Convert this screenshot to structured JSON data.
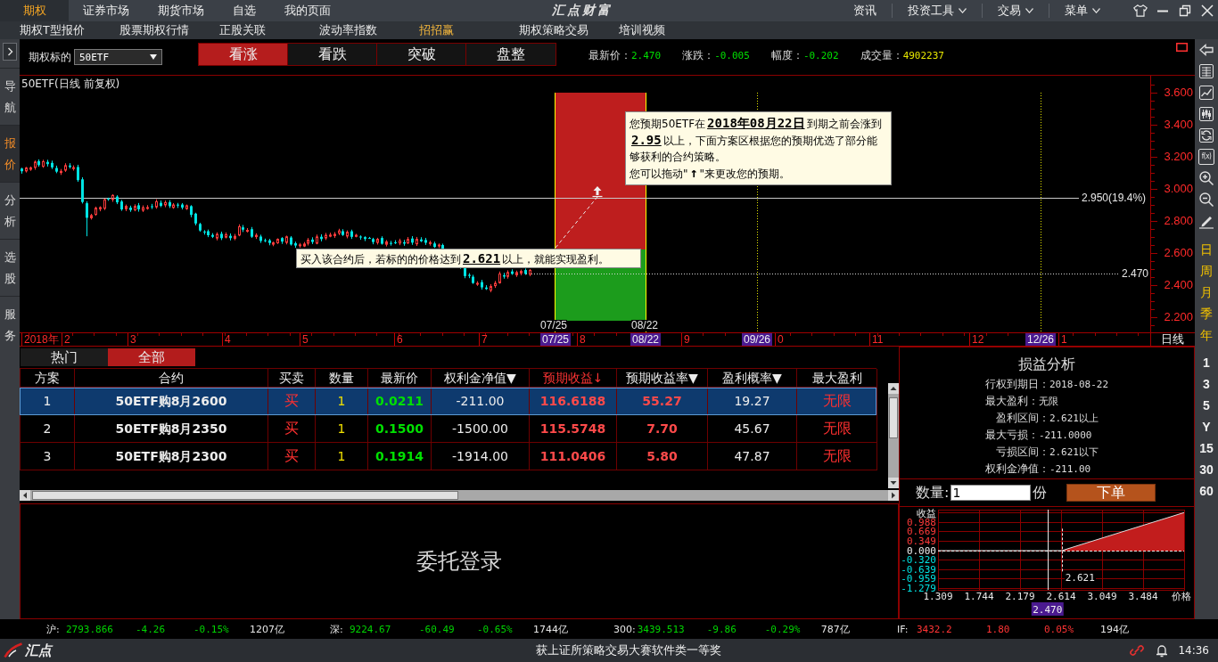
{
  "menu_bar": {
    "tabs": [
      {
        "label": "期权",
        "selected": true
      },
      {
        "label": "证券市场",
        "selected": false
      },
      {
        "label": "期货市场",
        "selected": false
      },
      {
        "label": "自选",
        "selected": false
      },
      {
        "label": "我的页面",
        "selected": false
      }
    ],
    "logo": "汇点财富",
    "menus": [
      {
        "label": "资讯",
        "dropdown": false
      },
      {
        "label": "投资工具",
        "dropdown": true
      },
      {
        "label": "交易",
        "dropdown": true
      },
      {
        "label": "菜单",
        "dropdown": true
      }
    ]
  },
  "sub_tabs": [
    {
      "label": "期权T型报价",
      "selected": false
    },
    {
      "label": "股票期权行情",
      "selected": false
    },
    {
      "label": "正股关联",
      "selected": false
    },
    {
      "label": "波动率指数",
      "selected": false
    },
    {
      "label": "招招赢",
      "selected": true
    },
    {
      "label": "期权策略交易",
      "selected": false
    },
    {
      "label": "培训视频",
      "selected": false
    }
  ],
  "left_nav": [
    {
      "label": "导航",
      "selected": false
    },
    {
      "label": "报价",
      "selected": true
    },
    {
      "label": "分析",
      "selected": false
    },
    {
      "label": "选股",
      "selected": false
    },
    {
      "label": "服务",
      "selected": false
    }
  ],
  "controls": {
    "underlying_label": "期权标的",
    "underlying_value": "50ETF",
    "outlooks": [
      {
        "label": "看涨",
        "selected": true
      },
      {
        "label": "看跌",
        "selected": false
      },
      {
        "label": "突破",
        "selected": false
      },
      {
        "label": "盘整",
        "selected": false
      }
    ],
    "quotes": [
      {
        "label": "最新价：",
        "value": "2.470",
        "color": "#00e000"
      },
      {
        "label": "涨跌：",
        "value": "-0.005",
        "color": "#00e000"
      },
      {
        "label": "幅度：",
        "value": "-0.202",
        "color": "#00e000"
      },
      {
        "label": "成交量：",
        "value": "4902237",
        "color": "#e6e600"
      }
    ]
  },
  "chart": {
    "title": "50ETF(日线 前复权)",
    "y_axis_labels": [
      "3.600",
      "3.400",
      "3.200",
      "3.000",
      "2.800",
      "2.600",
      "2.400",
      "2.200"
    ],
    "x_axis_labels": [
      {
        "label": "2018年",
        "kind": "month"
      },
      {
        "label": "2",
        "kind": "month"
      },
      {
        "label": "3",
        "kind": "month"
      },
      {
        "label": "4",
        "kind": "month"
      },
      {
        "label": "5",
        "kind": "month"
      },
      {
        "label": "6",
        "kind": "month"
      },
      {
        "label": "7",
        "kind": "month"
      },
      {
        "label": "07/25",
        "kind": "marker"
      },
      {
        "label": "8",
        "kind": "month"
      },
      {
        "label": "08/22",
        "kind": "marker"
      },
      {
        "label": "9",
        "kind": "month"
      },
      {
        "label": "09/26",
        "kind": "marker"
      },
      {
        "label": "0",
        "kind": "month"
      },
      {
        "label": "11",
        "kind": "month"
      },
      {
        "label": "12",
        "kind": "month"
      },
      {
        "label": "12/26",
        "kind": "marker"
      },
      {
        "label": "1",
        "kind": "month"
      },
      {
        "label": "日线",
        "kind": "period"
      }
    ],
    "target_label": "2.950(19.4%)",
    "current_label": "2.470",
    "zone_dates": [
      "07/25",
      "08/22"
    ],
    "expectation_tip": "您预期50ETF在**2018年08月22日**到期之前会涨到**2.95**以上，下面方案区根据您的预期优选了部分能够获利的合约策略。",
    "drag_tip": "您可以拖动\"**↑**\"来更改您的预期。",
    "breakeven_tip": "买入该合约后，若标的的价格达到**2.621**以上，就能实现盈利。"
  },
  "right_toolbar": {
    "formula": "f(x)",
    "periods": [
      "日",
      "周",
      "月",
      "季",
      "年"
    ],
    "intervals": [
      "1",
      "3",
      "5",
      "Y",
      "15",
      "30",
      "60"
    ]
  },
  "strategy_table": {
    "tabs": [
      {
        "label": "热门",
        "selected": false
      },
      {
        "label": "全部",
        "selected": true
      }
    ],
    "columns": [
      {
        "label": "方案",
        "sorted": false
      },
      {
        "label": "合约",
        "sorted": false
      },
      {
        "label": "买卖",
        "sorted": false
      },
      {
        "label": "数量",
        "sorted": false
      },
      {
        "label": "最新价",
        "sorted": false
      },
      {
        "label": "权利金净值▼",
        "sorted": false
      },
      {
        "label": "预期收益↓",
        "sorted": true
      },
      {
        "label": "预期收益率▼",
        "sorted": false
      },
      {
        "label": "盈利概率▼",
        "sorted": false
      },
      {
        "label": "最大盈利",
        "sorted": false
      }
    ],
    "rows": [
      {
        "selected": true,
        "cells": [
          "1",
          "50ETF购8月2600",
          "买",
          "1",
          "0.0211",
          "-211.00",
          "116.6188",
          "55.27",
          "19.27",
          "无限"
        ]
      },
      {
        "selected": false,
        "cells": [
          "2",
          "50ETF购8月2350",
          "买",
          "1",
          "0.1500",
          "-1500.00",
          "115.5748",
          "7.70",
          "45.67",
          "无限"
        ]
      },
      {
        "selected": false,
        "cells": [
          "3",
          "50ETF购8月2300",
          "买",
          "1",
          "0.1914",
          "-1914.00",
          "111.0406",
          "5.80",
          "47.87",
          "无限"
        ]
      }
    ]
  },
  "order_entry": {
    "title": "委托登录"
  },
  "analysis": {
    "title": "损益分析",
    "lines": [
      {
        "label": "行权到期日：",
        "value": "2018-08-22",
        "kind": "main"
      },
      {
        "label": "最大盈利：",
        "value": "无限",
        "kind": "main"
      },
      {
        "label": "盈利区间：",
        "value": "2.621以上",
        "kind": "sub"
      },
      {
        "label": "最大亏损：",
        "value": "-211.0000",
        "kind": "main"
      },
      {
        "label": "亏损区间：",
        "value": "2.621以下",
        "kind": "sub"
      },
      {
        "label": "权利金净值：",
        "value": "-211.00",
        "kind": "main"
      }
    ],
    "quantity_label": "数量:",
    "quantity_value": "1",
    "unit": "份",
    "submit": "下单"
  },
  "payoff_chart": {
    "chart_data": {
      "type": "area",
      "xlabel": "价格",
      "ylabel": "收益",
      "x": [
        1.309,
        2.621,
        3.919
      ],
      "series": [
        {
          "color": "#c21d1d",
          "values": [
            0,
            0,
            1.3
          ]
        }
      ],
      "xlim": [
        1.309,
        3.919
      ],
      "ylim": [
        -1.34,
        1.4
      ],
      "xticks": [
        1.309,
        1.744,
        2.179,
        2.614,
        3.049,
        3.484
      ],
      "yticks": [
        0.988,
        0.669,
        0.349,
        {
          "value": 0,
          "label": "0.000"
        },
        {
          "value": -0.32,
          "label": "-0.320"
        },
        -0.639,
        -0.959,
        -1.279
      ],
      "grid": true,
      "ref_lines": [
        {
          "axis": "y",
          "value": 0
        },
        {
          "axis": "x",
          "value": 2.621,
          "label": "2.621"
        },
        {
          "axis": "x",
          "value": 2.47,
          "label": "2.470"
        }
      ]
    }
  },
  "status_bar": [
    {
      "name": "沪:",
      "price": "2793.866",
      "change": "-4.26",
      "percent": "-0.15%",
      "turnover": "1207亿",
      "rising": false
    },
    {
      "name": "深:",
      "price": "9224.67",
      "change": "-60.49",
      "percent": "-0.65%",
      "turnover": "1744亿",
      "rising": false
    },
    {
      "name": "300:",
      "price": "3439.513",
      "change": "-9.86",
      "percent": "-0.29%",
      "turnover": "787亿",
      "rising": false
    },
    {
      "name": "IF:",
      "price": "3432.2",
      "change": "1.80",
      "percent": "0.05%",
      "turnover": "194亿",
      "rising": true
    }
  ],
  "footer": {
    "logo": "汇点",
    "ticker": "获上证所策略交易大赛软件类一等奖",
    "time": "14:36"
  }
}
